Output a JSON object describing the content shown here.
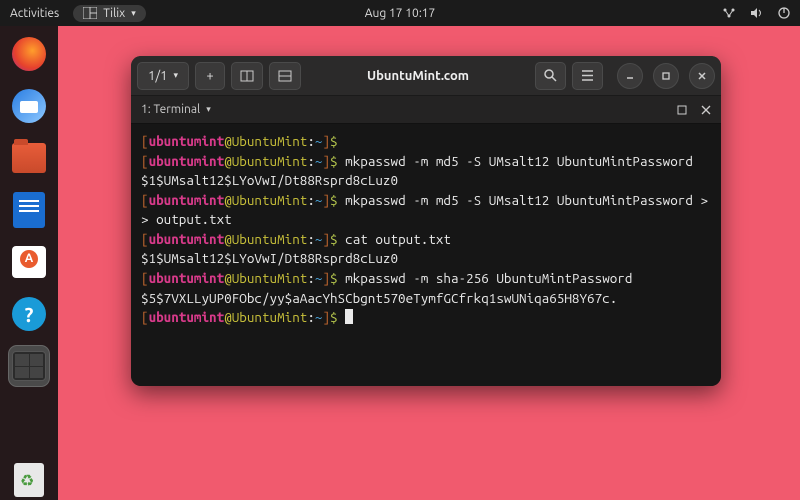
{
  "topbar": {
    "activities": "Activities",
    "app_name": "Tilix",
    "datetime": "Aug 17  10:17"
  },
  "dock": {
    "items": [
      {
        "name": "firefox",
        "active": false
      },
      {
        "name": "thunderbird",
        "active": false
      },
      {
        "name": "files",
        "active": false
      },
      {
        "name": "writer",
        "active": false
      },
      {
        "name": "software",
        "active": false
      },
      {
        "name": "help",
        "active": false
      },
      {
        "name": "tilix-terminal",
        "active": true
      }
    ],
    "trash": "trash"
  },
  "tilix": {
    "session_label": "1/1",
    "title": "UbuntuMint.com",
    "tab_label": "1: Terminal"
  },
  "prompt": {
    "open": "[",
    "user": "ubuntumint",
    "at": "@",
    "host": "UbuntuMint",
    "colon": ":",
    "path": "~",
    "close": "]",
    "dollar": "$"
  },
  "lines": [
    {
      "type": "prompt",
      "cmd": ""
    },
    {
      "type": "prompt",
      "cmd": "mkpasswd -m md5 -S UMsalt12 UbuntuMintPassword"
    },
    {
      "type": "out",
      "text": "$1$UMsalt12$LYoVwI/Dt88Rsprd8cLuz0"
    },
    {
      "type": "prompt",
      "cmd": "mkpasswd -m md5 -S UMsalt12 UbuntuMintPassword >> output.txt"
    },
    {
      "type": "prompt",
      "cmd": "cat output.txt"
    },
    {
      "type": "out",
      "text": "$1$UMsalt12$LYoVwI/Dt88Rsprd8cLuz0"
    },
    {
      "type": "prompt",
      "cmd": "mkpasswd -m sha-256 UbuntuMintPassword"
    },
    {
      "type": "out",
      "text": "$5$7VXLLyUP0FObc/yy$aAacYhSCbgnt570eTymfGCfrkq1swUNiqa65H8Y67c."
    },
    {
      "type": "prompt",
      "cmd": "",
      "cursor": true
    }
  ]
}
